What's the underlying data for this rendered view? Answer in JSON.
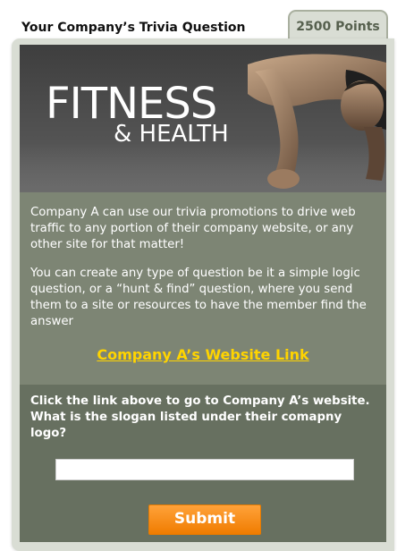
{
  "header": {
    "title": "Your Company’s Trivia Question",
    "points": "2500 Points"
  },
  "banner": {
    "line1": "FITNESS",
    "line2": "& HEALTH"
  },
  "content": {
    "paragraph1": "Company A can use our trivia promotions to drive web traffic to any portion of their company website, or any other site for that matter!",
    "paragraph2": "You can create any type of question be it a simple logic question, or a “hunt & find” question, where you send them to a site or resources to have the member find the answer",
    "link_label": "Company A’s Website Link"
  },
  "question": {
    "text": "Click the link above to go to Company A’s website.  What is the slogan listed under their comapny logo?",
    "answer_value": "",
    "submit_label": "Submit"
  },
  "colors": {
    "link": "#ffd400",
    "submit": "#f68b1e",
    "card_bg": "#7d8574"
  }
}
